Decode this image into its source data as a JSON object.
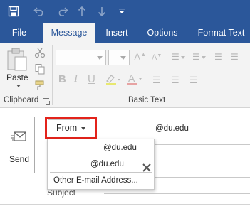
{
  "tabs": [
    {
      "label": "File",
      "active": false
    },
    {
      "label": "Message",
      "active": true
    },
    {
      "label": "Insert",
      "active": false
    },
    {
      "label": "Options",
      "active": false
    },
    {
      "label": "Format Text",
      "active": false
    }
  ],
  "ribbon": {
    "clipboard": {
      "paste_label": "Paste",
      "group_label": "Clipboard"
    },
    "basic_text": {
      "group_label": "Basic Text"
    }
  },
  "compose": {
    "send_label": "Send",
    "from_button_label": "From",
    "from_address": "@du.edu",
    "subject_label": "Subject"
  },
  "from_menu": {
    "accounts": [
      "@du.edu",
      "@du.edu"
    ],
    "other_label": "Other E-mail Address..."
  },
  "colors": {
    "titlebar": "#2b579a",
    "ribbon": "#f3f3f3",
    "highlight": "#e3231b"
  },
  "icons": {
    "save": "save-icon",
    "undo": "undo-icon",
    "redo": "redo-icon",
    "up": "arrow-up-icon",
    "down": "arrow-down-icon",
    "customize": "qat-customize-icon"
  }
}
